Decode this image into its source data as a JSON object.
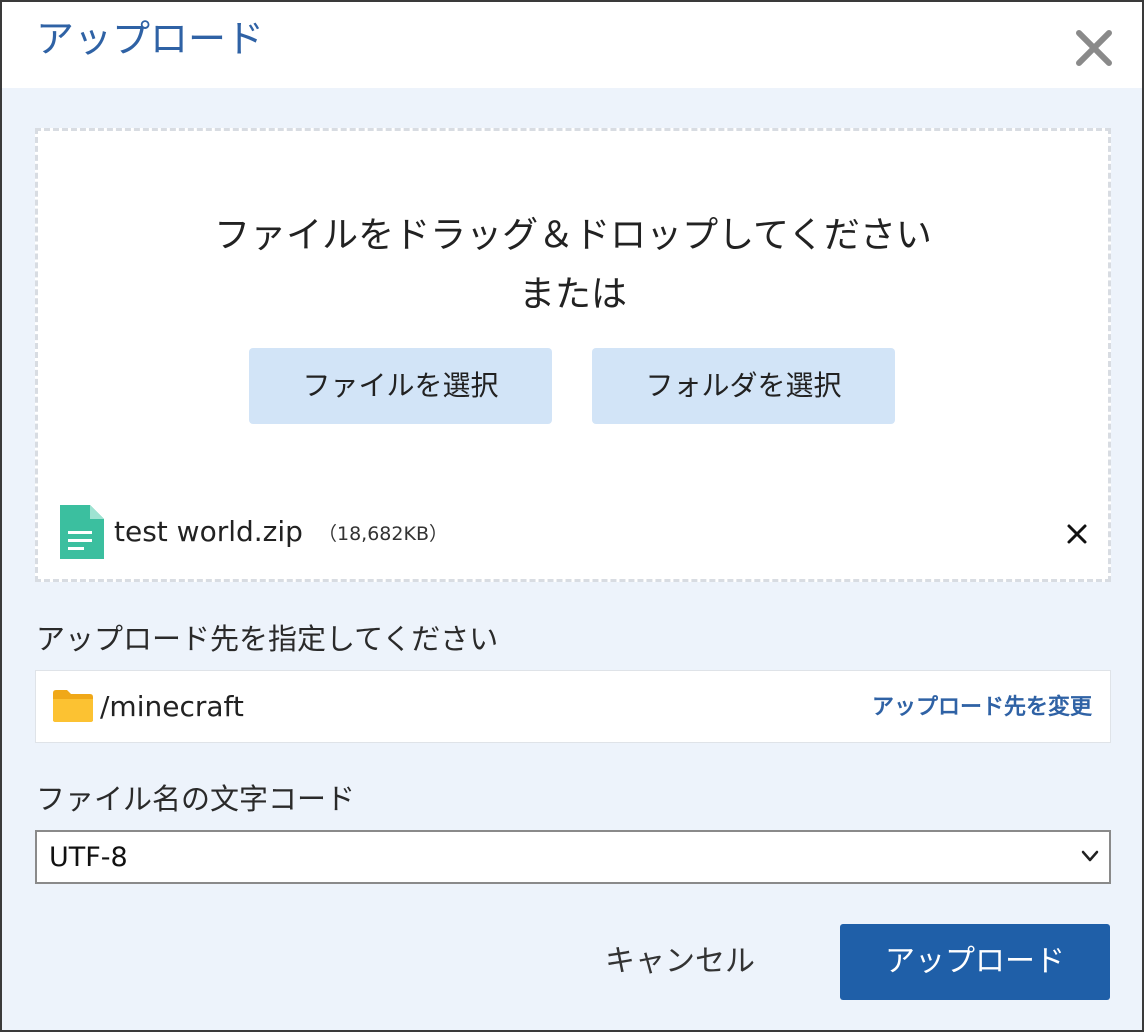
{
  "dialog": {
    "title": "アップロード",
    "close_icon": "close-icon"
  },
  "dropzone": {
    "instruction": "ファイルをドラッグ＆ドロップしてください",
    "or_text": "または",
    "select_file_label": "ファイルを選択",
    "select_folder_label": "フォルダを選択",
    "files": [
      {
        "name": "test world.zip",
        "size": "（18,682KB）",
        "icon": "document-icon",
        "remove_icon": "remove-icon"
      }
    ]
  },
  "destination": {
    "label": "アップロード先を指定してください",
    "path": "/minecraft",
    "icon": "folder-icon",
    "change_label": "アップロード先を変更"
  },
  "encoding": {
    "label": "ファイル名の文字コード",
    "selected": "UTF-8",
    "icon": "chevron-down-icon"
  },
  "actions": {
    "cancel_label": "キャンセル",
    "upload_label": "アップロード"
  },
  "colors": {
    "accent": "#2f62a5",
    "primary_button": "#1f5fa8",
    "secondary_button": "#d2e4f7",
    "background": "#edf3fb",
    "file_icon": "#3bbf9f",
    "folder_icon": "#f8b619"
  }
}
